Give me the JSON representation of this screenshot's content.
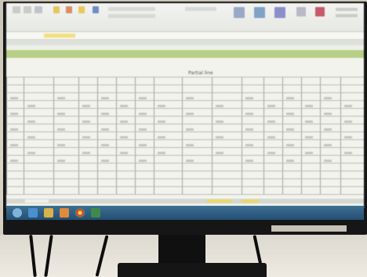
{
  "photo": {
    "subject": "",
    "sheet_title": "Partial line"
  },
  "colors": {
    "green_row": "#b7cf86",
    "taskbar": "#2f5d82",
    "sheet_bg": "#f3f3ee"
  },
  "icons": [
    "windows-start-icon",
    "ie-icon",
    "folder-icon",
    "media-icon",
    "chrome-icon",
    "excel-icon"
  ]
}
